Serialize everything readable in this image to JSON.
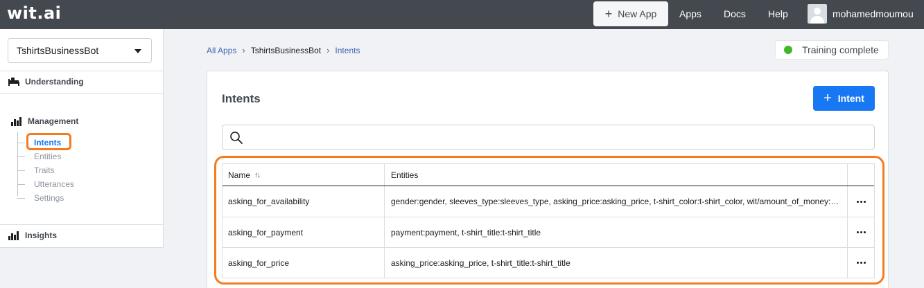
{
  "topbar": {
    "logo": "wit.ai",
    "new_app_label": "New App",
    "nav": [
      "Apps",
      "Docs",
      "Help"
    ],
    "username": "mohamedmoumou"
  },
  "sidebar": {
    "app_name": "TshirtsBusinessBot",
    "sections": {
      "understanding": "Understanding",
      "management": "Management",
      "insights": "Insights"
    },
    "management_items": [
      {
        "label": "Intents",
        "active": true
      },
      {
        "label": "Entities",
        "active": false
      },
      {
        "label": "Traits",
        "active": false
      },
      {
        "label": "Utterances",
        "active": false
      },
      {
        "label": "Settings",
        "active": false
      }
    ]
  },
  "breadcrumb": [
    "All Apps",
    "TshirtsBusinessBot",
    "Intents"
  ],
  "status": {
    "text": "Training complete",
    "color": "#42b72a"
  },
  "main": {
    "title": "Intents",
    "add_button_label": "Intent",
    "search": {
      "value": "",
      "placeholder": ""
    },
    "table": {
      "columns": [
        "Name",
        "Entities"
      ],
      "rows": [
        {
          "name": "asking_for_availability",
          "entities": "gender:gender, sleeves_type:sleeves_type, asking_price:asking_price, t-shirt_color:t-shirt_color, wit/amount_of_money:amount_of_money"
        },
        {
          "name": "asking_for_payment",
          "entities": "payment:payment, t-shirt_title:t-shirt_title"
        },
        {
          "name": "asking_for_price",
          "entities": "asking_price:asking_price, t-shirt_title:t-shirt_title"
        }
      ]
    }
  },
  "colors": {
    "topbar": "#444950",
    "accent": "#1877f2",
    "annotation": "#f47b20"
  }
}
